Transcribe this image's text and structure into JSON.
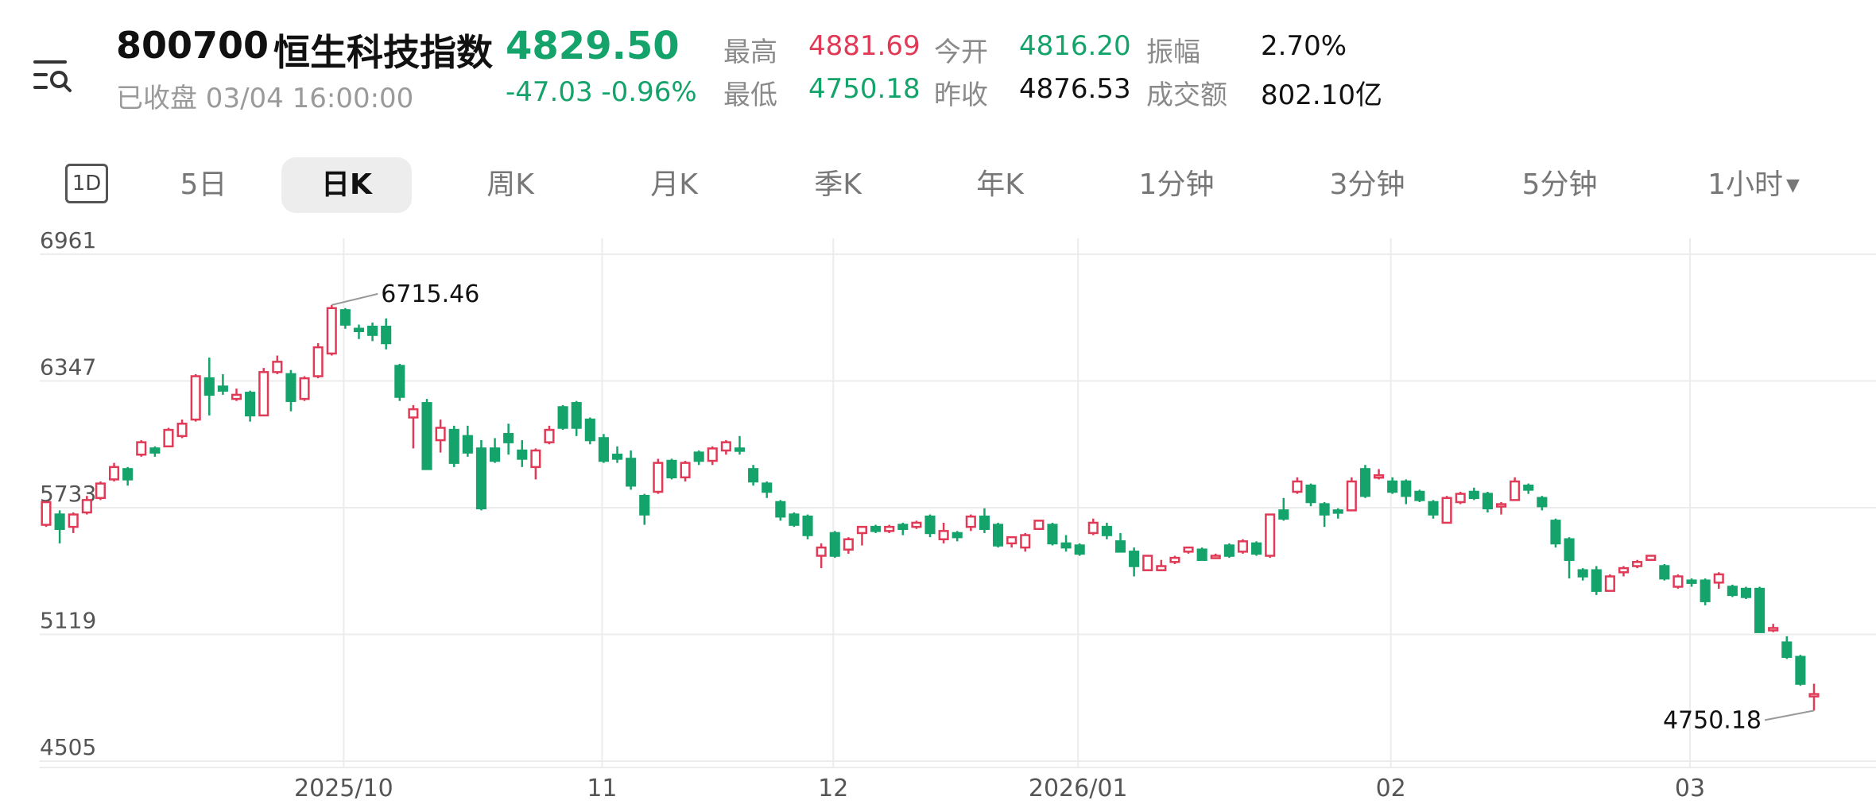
{
  "header": {
    "code": "800700",
    "name": "恒生科技指数",
    "price": "4829.50",
    "status": "已收盘 03/04 16:00:00",
    "change": "-47.03 -0.96%"
  },
  "stats": {
    "high_label": "最高",
    "high_value": "4881.69",
    "open_label": "今开",
    "open_value": "4816.20",
    "amp_label": "振幅",
    "amp_value": "2.70%",
    "low_label": "最低",
    "low_value": "4750.18",
    "prev_label": "昨收",
    "prev_value": "4876.53",
    "turnover_label": "成交额",
    "turnover_value": "802.10亿"
  },
  "tabs": {
    "icon_label": "1D",
    "items": [
      "5日",
      "日K",
      "周K",
      "月K",
      "季K",
      "年K",
      "1分钟",
      "3分钟",
      "5分钟",
      "1小时"
    ],
    "active": "日K"
  },
  "colors": {
    "up": "#e03a57",
    "down": "#14a36a",
    "grid": "#ececec"
  },
  "chart_data": {
    "type": "candlestick",
    "y_ticks": [
      "6961",
      "6347",
      "5733",
      "5119",
      "4505"
    ],
    "ylim": [
      4505,
      6961
    ],
    "x_labels": [
      "2025/10",
      "11",
      "12",
      "2026/01",
      "02",
      "03"
    ],
    "max_annotation": "6715.46",
    "min_annotation": "4750.18",
    "candles": [
      [
        5650,
        5760,
        5640,
        5720
      ],
      [
        5700,
        5630,
        5560,
        5720
      ],
      [
        5640,
        5700,
        5610,
        5710
      ],
      [
        5710,
        5770,
        5700,
        5790
      ],
      [
        5780,
        5850,
        5770,
        5860
      ],
      [
        5870,
        5930,
        5860,
        5950
      ],
      [
        5920,
        5870,
        5840,
        5930
      ],
      [
        5990,
        6050,
        5980,
        6060
      ],
      [
        6020,
        6000,
        5980,
        6030
      ],
      [
        6030,
        6110,
        6030,
        6120
      ],
      [
        6080,
        6140,
        6070,
        6160
      ],
      [
        6160,
        6370,
        6150,
        6380
      ],
      [
        6360,
        6280,
        6180,
        6460
      ],
      [
        6320,
        6300,
        6280,
        6380
      ],
      [
        6260,
        6280,
        6250,
        6310
      ],
      [
        6290,
        6180,
        6150,
        6300
      ],
      [
        6180,
        6390,
        6180,
        6410
      ],
      [
        6390,
        6440,
        6380,
        6470
      ],
      [
        6380,
        6250,
        6200,
        6400
      ],
      [
        6260,
        6360,
        6250,
        6370
      ],
      [
        6370,
        6510,
        6360,
        6530
      ],
      [
        6480,
        6700,
        6470,
        6715
      ],
      [
        6690,
        6620,
        6600,
        6700
      ],
      [
        6600,
        6590,
        6550,
        6620
      ],
      [
        6610,
        6570,
        6540,
        6630
      ],
      [
        6610,
        6530,
        6500,
        6650
      ],
      [
        6420,
        6270,
        6250,
        6430
      ],
      [
        6170,
        6210,
        6020,
        6230
      ],
      [
        6240,
        5920,
        5920,
        6260
      ],
      [
        6060,
        6120,
        6000,
        6160
      ],
      [
        6110,
        5950,
        5930,
        6130
      ],
      [
        6080,
        6000,
        5980,
        6130
      ],
      [
        6020,
        5730,
        5720,
        6060
      ],
      [
        6020,
        5960,
        5950,
        6070
      ],
      [
        6090,
        6050,
        5990,
        6140
      ],
      [
        6010,
        5970,
        5930,
        6060
      ],
      [
        5930,
        6010,
        5870,
        6020
      ],
      [
        6050,
        6110,
        6040,
        6130
      ],
      [
        6220,
        6120,
        6110,
        6230
      ],
      [
        6240,
        6120,
        6080,
        6250
      ],
      [
        6160,
        6060,
        6040,
        6170
      ],
      [
        6070,
        5960,
        5950,
        6090
      ],
      [
        5990,
        5970,
        5950,
        6030
      ],
      [
        5970,
        5840,
        5820,
        6010
      ],
      [
        5790,
        5700,
        5650,
        5800
      ],
      [
        5810,
        5950,
        5800,
        5970
      ],
      [
        5960,
        5880,
        5870,
        5970
      ],
      [
        5880,
        5950,
        5860,
        5960
      ],
      [
        6000,
        5960,
        5940,
        6010
      ],
      [
        5960,
        6020,
        5940,
        6030
      ],
      [
        6010,
        6050,
        5990,
        6060
      ],
      [
        6020,
        6010,
        5990,
        6080
      ],
      [
        5920,
        5860,
        5840,
        5940
      ],
      [
        5850,
        5810,
        5780,
        5860
      ],
      [
        5760,
        5690,
        5670,
        5770
      ],
      [
        5700,
        5650,
        5640,
        5710
      ],
      [
        5690,
        5600,
        5580,
        5700
      ],
      [
        5500,
        5540,
        5440,
        5560
      ],
      [
        5610,
        5500,
        5490,
        5620
      ],
      [
        5530,
        5580,
        5510,
        5590
      ],
      [
        5610,
        5640,
        5550,
        5640
      ],
      [
        5640,
        5620,
        5610,
        5650
      ],
      [
        5620,
        5640,
        5610,
        5650
      ],
      [
        5650,
        5630,
        5600,
        5660
      ],
      [
        5640,
        5660,
        5630,
        5670
      ],
      [
        5690,
        5610,
        5590,
        5700
      ],
      [
        5580,
        5620,
        5560,
        5660
      ],
      [
        5610,
        5590,
        5570,
        5620
      ],
      [
        5640,
        5690,
        5620,
        5700
      ],
      [
        5690,
        5630,
        5610,
        5730
      ],
      [
        5650,
        5550,
        5540,
        5660
      ],
      [
        5560,
        5590,
        5540,
        5590
      ],
      [
        5540,
        5600,
        5520,
        5610
      ],
      [
        5630,
        5670,
        5630,
        5670
      ],
      [
        5650,
        5560,
        5550,
        5660
      ],
      [
        5560,
        5540,
        5520,
        5600
      ],
      [
        5550,
        5510,
        5500,
        5560
      ],
      [
        5610,
        5660,
        5600,
        5680
      ],
      [
        5640,
        5600,
        5580,
        5660
      ],
      [
        5570,
        5520,
        5520,
        5610
      ],
      [
        5520,
        5450,
        5400,
        5540
      ],
      [
        5430,
        5500,
        5430,
        5500
      ],
      [
        5430,
        5450,
        5430,
        5480
      ],
      [
        5470,
        5490,
        5460,
        5500
      ],
      [
        5520,
        5540,
        5510,
        5530
      ],
      [
        5530,
        5480,
        5480,
        5540
      ],
      [
        5490,
        5500,
        5490,
        5510
      ],
      [
        5550,
        5500,
        5490,
        5560
      ],
      [
        5520,
        5570,
        5510,
        5580
      ],
      [
        5560,
        5510,
        5500,
        5570
      ],
      [
        5500,
        5700,
        5490,
        5700
      ],
      [
        5720,
        5680,
        5670,
        5780
      ],
      [
        5810,
        5860,
        5800,
        5880
      ],
      [
        5840,
        5760,
        5740,
        5850
      ],
      [
        5750,
        5700,
        5640,
        5760
      ],
      [
        5720,
        5710,
        5680,
        5730
      ],
      [
        5720,
        5860,
        5720,
        5880
      ],
      [
        5920,
        5790,
        5780,
        5940
      ],
      [
        5880,
        5890,
        5870,
        5920
      ],
      [
        5860,
        5810,
        5800,
        5880
      ],
      [
        5860,
        5790,
        5750,
        5870
      ],
      [
        5810,
        5770,
        5760,
        5820
      ],
      [
        5760,
        5700,
        5680,
        5770
      ],
      [
        5660,
        5780,
        5660,
        5790
      ],
      [
        5760,
        5800,
        5750,
        5810
      ],
      [
        5810,
        5780,
        5770,
        5830
      ],
      [
        5800,
        5730,
        5710,
        5810
      ],
      [
        5740,
        5750,
        5700,
        5760
      ],
      [
        5770,
        5860,
        5770,
        5880
      ],
      [
        5840,
        5820,
        5800,
        5850
      ],
      [
        5780,
        5740,
        5720,
        5790
      ],
      [
        5670,
        5560,
        5540,
        5680
      ],
      [
        5580,
        5480,
        5390,
        5590
      ],
      [
        5430,
        5400,
        5380,
        5440
      ],
      [
        5430,
        5330,
        5310,
        5450
      ],
      [
        5330,
        5400,
        5330,
        5410
      ],
      [
        5420,
        5440,
        5400,
        5450
      ],
      [
        5450,
        5470,
        5440,
        5480
      ],
      [
        5480,
        5500,
        5480,
        5490
      ],
      [
        5450,
        5390,
        5380,
        5460
      ],
      [
        5350,
        5400,
        5340,
        5410
      ],
      [
        5380,
        5370,
        5350,
        5390
      ],
      [
        5380,
        5280,
        5260,
        5390
      ],
      [
        5370,
        5410,
        5340,
        5420
      ],
      [
        5350,
        5310,
        5300,
        5360
      ],
      [
        5340,
        5300,
        5290,
        5350
      ],
      [
        5340,
        5130,
        5130,
        5350
      ],
      [
        5140,
        5150,
        5130,
        5170
      ],
      [
        5080,
        5010,
        5000,
        5110
      ],
      [
        5010,
        4880,
        4870,
        5020
      ],
      [
        4820,
        4830,
        4750,
        4880
      ]
    ]
  }
}
